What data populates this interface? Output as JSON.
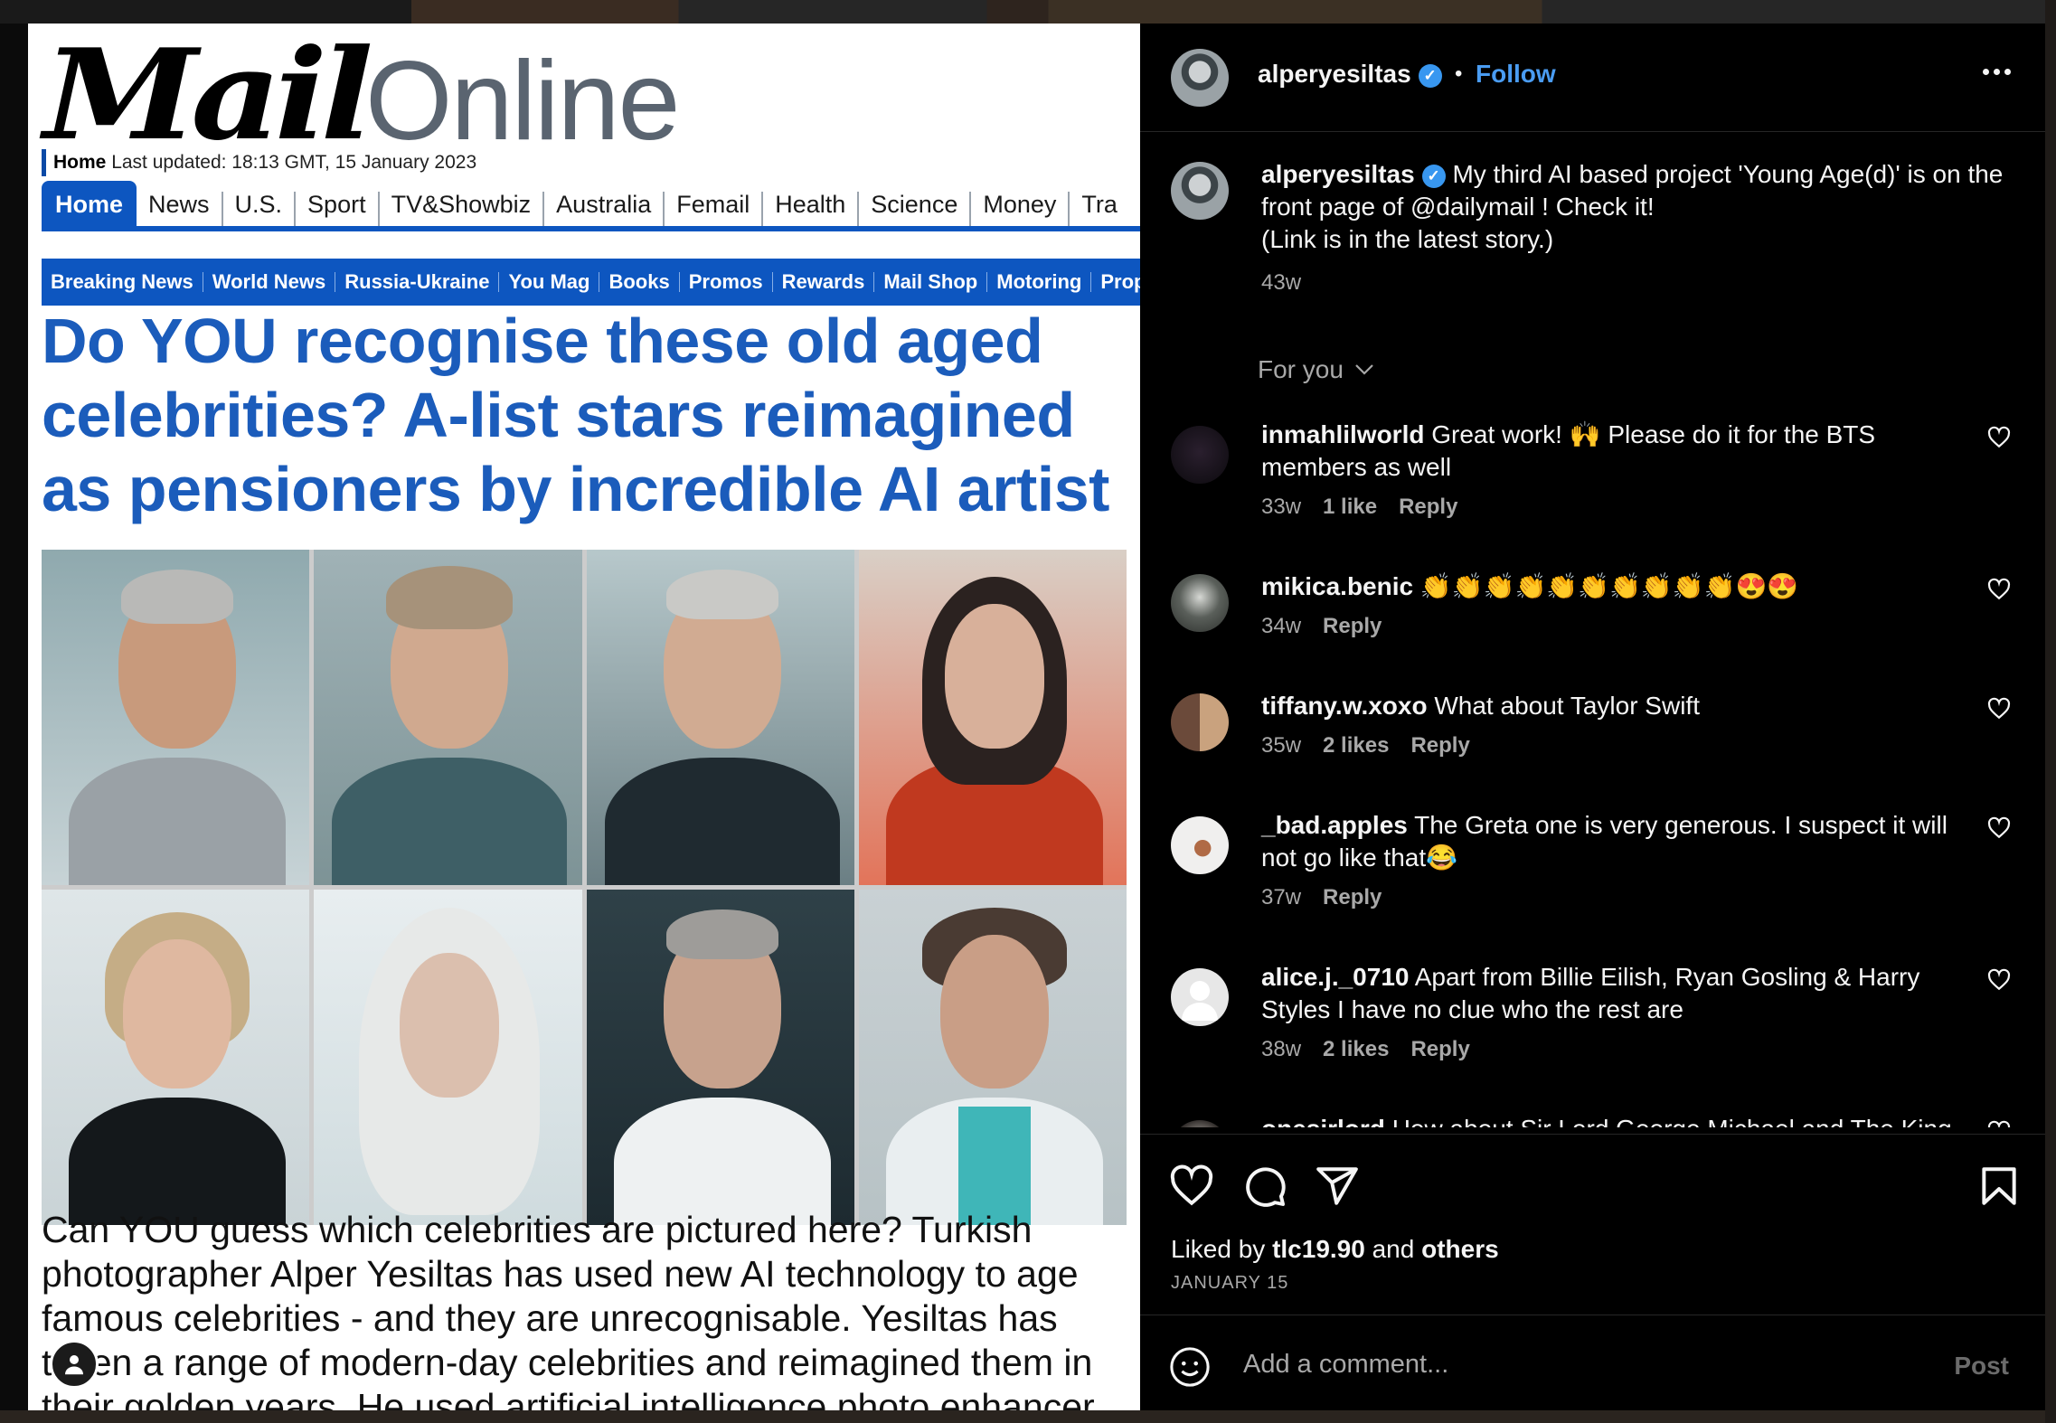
{
  "article": {
    "logo_mail": "Mail",
    "logo_online": "Online",
    "updated_home": "Home",
    "updated_text": " Last updated: 18:13 GMT, 15 January 2023",
    "nav_primary": [
      "Home",
      "News",
      "U.S.",
      "Sport",
      "TV&Showbiz",
      "Australia",
      "Femail",
      "Health",
      "Science",
      "Money",
      "Tra"
    ],
    "nav_secondary": [
      "Breaking News",
      "World News",
      "Russia-Ukraine",
      "You Mag",
      "Books",
      "Promos",
      "Rewards",
      "Mail Shop",
      "Motoring",
      "Propert"
    ],
    "headline": "Do YOU recognise these old aged celebrities? A-list stars reimagined as pensioners by incredible AI artist",
    "caption": "Can YOU guess which celebrities are pictured here? Turkish photographer Alper Yesiltas has used new AI technology to age famous celebrities - and they are unrecognisable. Yesiltas has taken a range of modern-day celebrities and reimagined them in their golden years. He used artificial intelligence photo enhancer"
  },
  "post": {
    "username": "alperyesiltas",
    "follow_label": "Follow",
    "caption_text": "My third AI based project 'Young Age(d)' is on the front page of @dailymail ! Check it!",
    "caption_line2": "(Link is in the latest story.)",
    "caption_age": "43w",
    "for_you": "For you",
    "liked_by_prefix": "Liked by",
    "liked_by_user": "tlc19.90",
    "liked_by_and": "and",
    "liked_by_others": "others",
    "date": "JANUARY 15",
    "add_comment_placeholder": "Add a comment...",
    "post_label": "Post"
  },
  "comments": [
    {
      "user": "inmahlilworld",
      "text": "Great work! 🙌 Please do it for the BTS members as well",
      "age": "33w",
      "likes": "1 like",
      "reply": "Reply"
    },
    {
      "user": "mikica.benic",
      "text": "👏👏👏👏👏👏👏👏👏👏😍😍",
      "age": "34w",
      "likes": "",
      "reply": "Reply"
    },
    {
      "user": "tiffany.w.xoxo",
      "text": "What about Taylor Swift",
      "age": "35w",
      "likes": "2 likes",
      "reply": "Reply"
    },
    {
      "user": "_bad.apples",
      "text": "The Greta one is very generous. I suspect it will not go like that😂",
      "age": "37w",
      "likes": "",
      "reply": "Reply"
    },
    {
      "user": "alice.j._0710",
      "text": "Apart from Billie Eilish, Ryan Gosling & Harry Styles I have no clue who the rest are",
      "age": "38w",
      "likes": "2 likes",
      "reply": "Reply"
    },
    {
      "user": "onesirlord",
      "text": "How about Sir Lord George Michael and The King",
      "age": "",
      "likes": "",
      "reply": ""
    }
  ],
  "colors": {
    "mail_blue": "#1b5cbb",
    "nav_blue": "#0d56c0",
    "ig_link": "#4a9cf2",
    "ig_muted": "#a8a8a8"
  },
  "icons": [
    "heart-icon",
    "comment-icon",
    "share-icon",
    "bookmark-icon",
    "emoji-icon",
    "more-icon",
    "verified-icon"
  ]
}
